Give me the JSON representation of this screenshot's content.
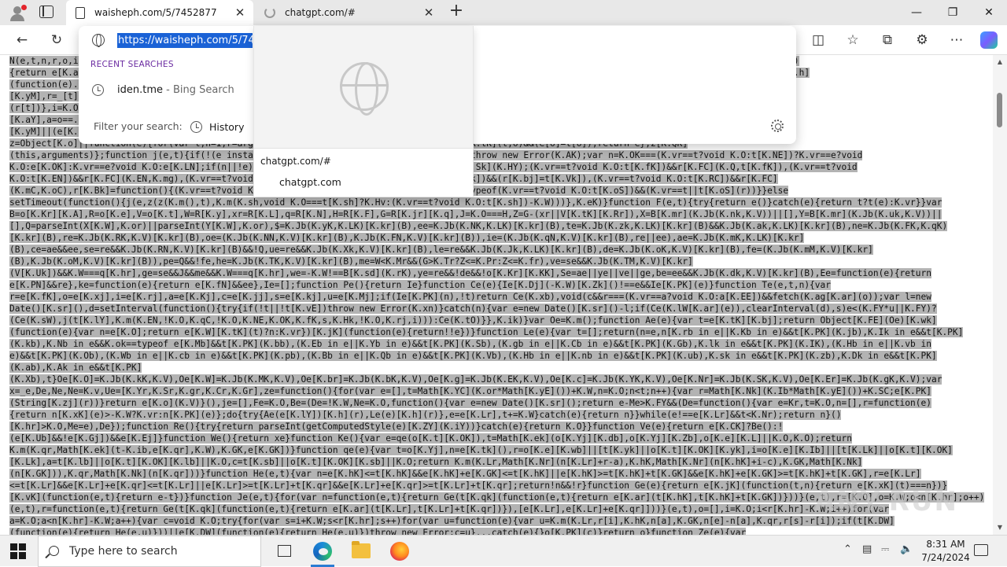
{
  "browser": {
    "tabs": [
      {
        "label": "waisheph.com/5/7452877",
        "close": "✕"
      },
      {
        "label": "chatgpt.com/#",
        "close": "✕"
      }
    ],
    "new_tab": "+",
    "window_controls": {
      "minimize": "—",
      "maximize": "❐",
      "close": "✕"
    }
  },
  "omnibox": {
    "url": "https://waisheph.com/5/7452877",
    "recent_heading": "RECENT SEARCHES",
    "recent_items": [
      {
        "term": "iden.tme",
        "source": " - Bing Search"
      }
    ],
    "filter_label": "Filter your search:",
    "history_label": "History"
  },
  "preview": {
    "url": "chatgpt.com/#",
    "title": "chatgpt.com"
  },
  "page": {
    "code_lines": [
      "N(e,t,n,r,o,i){...}......................................................................................................|L,s=Kr[c][K.jK](function(e)",
      "{return e[K.a............................................................................................................aS]=i[K.aS]),D[K.PK](u),_[K.h]",
      "(function(e)..............................................................................................................n=_[t][K.lY][K.tK][K.Rj]",
      "[K.yM],r=_[t]...............................................................................................................K]",
      "(r[t])},i=K.O...........................................................................................................[K.aY],o=e[K.xj],i=r===n[t]",
      "[K.aY],a=o==............................................................................................................(function(e){e[K.lY][K.Rj]",
      "[K.yM]||(e[K.............................................................................................................}});var z=function(){return",
      "z=Object[K.o]||function(e){for(var t,n=1,r=arguments...arguments[n])Object[K.tK][K.Rj][K.tK](t,o)&&(e[o]=t[o]);return e},z[K.QK]",
      "(this,arguments)};function j(e,t){if(!(e instanceof t))throw new TypeError(...t[K.Vk]))throw new Error(K.AK);var n=K.OK===(K.vr==t?void K.O:t[K.NE])?K.vr==e?void",
      "K.O:e[K.OK]:K.vr==e?void K.O:e[K.LN];if(n||!e){...................................r=e[K.Sk](K.HY);(K.vr==t?void K.O:t[K.fK])&&r[K.FC](K.Q,t[K.fK]),(K.vr==t?void",
      "K.O:t[K.EN])&&r[K.FC](K.EN,K.mg),(K.vr==t?void K.O:t[K.Vk])...........=t?void K.O:t[K.Vk])&&(r[K.bj]=t[K.Vk]),(K.vr==t?void K.O:t[K.RC])&&r[K.FC]",
      "(K.mC,K.oC),r[K.Bk]=function(){(K.vr==t?void K.O:t[K.sh])...........,n[K.Ck](r),K.ok==typeof(K.vr==t?void K.O:t[K.oS])&&(K.vr==t||t[K.oS](r))}}else",
      "setTimeout(function(){j(e,z(z(K.m(),t),K.m(K.sh,void K.O===t[K.sh]?K.Hv:(K.vr==t?void K.O:t[K.sh])-K.W)))},K.eK)}function F(e,t){try{return e()}catch(e){return t?t(e):K.vr}}var",
      "B=o[K.Kr][K.A],R=o[K.e],V=o[K.t],W=R[K.y],xr=R[K.L],q=R[K.N],H=R[K.F],G=R[K.jr][K.q],J=K.O===H,Z=G-(xr||V[K.tK][K.Rr]),X=B[K.mr](K.Jb(K.nk,K.V))||[],Y=B[K.mr](K.Jb(K.uk,K.V))||",
      "[],Q=parseInt(X[K.W],K.or)||parseInt(Y[K.W],K.or),$=K.Jb(K.yK,K.LK)[K.kr](B),ee=K.Jb(K.NK,K.LK)[K.kr](B),te=K.Jb(K.zk,K.LK)[K.kr](B)&&K.Jb(K.ak,K.LK)[K.kr](B),ne=K.Jb(K.FK,K.qK)",
      "[K.kr](B),re=K.Jb(K.RK,K.V)[K.kr](B),oe=(K.Jb(K.NN,K.V)[K.kr](B),K.Jb(K.FN,K.V)[K.kr](B)),ie=(K.Jb(K.qN,K.V)[K.kr](B),re||ee),ae=K.Jb(K.mK,K.LK)[K.kr]",
      "(B),ce=ae&&ee,se=re&&K.Jb(K.RN,K.V)[K.kr](B)&&!Q,ue=re&&K.Jb(K.Xk,K.V)[K.kr](B),le=re&&K.Jb(K.Jk,K.LK)[K.kr](B),de=K.Jb(K.oK,K.V)[K.kr](B),fe=(K.Jb(K.mM,K.V)[K.kr]",
      "(B),K.Jb(K.oM,K.V)[K.kr](B)),pe=Q&&!fe,he=K.Jb(K.TK,K.V)[K.kr](B),me=W<K.Mr&&(G>K.Tr?Z<=K.Pr:Z<=K.fr),ve=se&&K.Jb(K.TM,K.V)[K.kr]",
      "(V[K.Uk])&&K.W===q[K.hr],ge=se&&J&&me&&K.W===q[K.hr],we=-K.W!==B[K.sd](K.rK),ye=re&&!de&&!o[K.Kr][K.KK],Se=ae||ye||ve||ge,be=ee&&K.Jb(K.dk,K.V)[K.kr](B),Ee=function(e){return",
      "e[K.PN]&&re},ke=function(e){return e[K.fN]&&ee},Ie=[];function Pe(){return Ie}function Ce(e){Ie[K.Dj](-K.W)[K.Zk]()!==e&&Ie[K.PK](e)}function Te(e,t,n){var",
      "r=e[K.fK],o=e[K.xj],i=e[K.rj],a=e[K.Kj],c=e[K.jj],s=e[K.kj],u=e[K.Mj];if(Ie[K.PK](n),!t)return Ce(K.xb),void(c&&r===(K.vr==a?void K.O:a[K.EE])&&fetch(K.ag[K.ar](o));var l=new",
      "Date()[K.sr](),d=setInterval(function(){try{if(!t||!t[K.vE])throw new Error(K.xn)}catch(n){var e=new Date()[K.sr]()-l;if(Ce(K.lW[K.ar](e)),clearInterval(d),s)e<(K.FY*u||K.FY)?",
      "(Ce(K.sW),j(t[K.lY],K.m(K.EN,!K.O,K.qC,!K.O,K.NE,K.OK,K.fK,s,K.Hk,!K.O,K.rj,i))):Ce(K.tO)}},K.ik)}var Oe=K.m();function Ae(e){var t=e[K.tK][K.bj];return Object[K.FE](Oe)[K.wk]",
      "(function(e){var n=e[K.O];return e[K.W][K.tK](t)?n:K.vr})[K.jK](function(e){return!!e})}function Le(e){var t=[];return(n=e,n[K.rb in e||K.Kb in e)&&t[K.PK](K.jb),K.Ik in e&&t[K.PK]",
      "(K.kb),K.Nb in e&&K.ok==typeof e[K.Mb]&&t[K.PK](K.bb),(K.Eb in e||K.Yb in e)&&t[K.PK](K.Sb),(K.gb in e||K.Cb in e)&&t[K.PK](K.Gb),K.lk in e&&t[K.PK](K.IK),(K.Hb in e||K.vb in",
      "e)&&t[K.PK](K.Ob),(K.Wb in e||K.cb in e)&&t[K.PK](K.pb),(K.Bb in e||K.Qb in e)&&t[K.PK](K.Vb),(K.Hb in e||K.nb in e)&&t[K.PK](K.ub),K.sk in e&&t[K.PK](K.zb),K.Dk in e&&t[K.PK]",
      "(K.ab),K.Ak in e&&t[K.PK]",
      "(K.Xb),t}Oe[K.O]=K.Jb(K.kK,K.V),Oe[K.W]=K.Jb(K.MK,K.V),Oe[K.br]=K.Jb(K.bK,K.V),Oe[K.g]=K.Jb(K.EK,K.V),Oe[K.c]=K.Jb(K.YK,K.V),Oe[K.Nr]=K.Jb(K.SK,K.V),Oe[K.Er]=K.Jb(K.gK,K.V);var",
      "x=_e,De,Ne,Ne=K.v,Ue=[K.Yr,K.Sr,K.gr,K.Cr,K.Gr],ze=function(){for(var e=[],t=Math[K.YC](K.or*Math[K.yE]())+K.W,n=K.O;n<t;n++){var r=Math[K.Nk](K.Ib*Math[K.yE]())+K.SC;e[K.PK]",
      "(String[K.zj](r))}return e[K.o](K.V)}(),je=[],Fe=K.O,Be=(De=!K.W,Ne=K.O,function(){var e=new Date()[K.sr]();return e-Me>K.FY&&(De=function(){var e=Kr,t=K.O,n=[],r=function(e)",
      "{return n[K.xK](e)>-K.W?K.vr:n[K.PK](e)};do{try{Ae(e[K.lY])[K.h](r),Le(e)[K.h](r)},e=e[K.Lr],t+=K.W}catch(e){return n}}while(e!==e[K.Lr]&&t<K.Nr);return n}()",
      "[K.hr]>K.O,Me=e),De});function Re(){try{return parseInt(getComputedStyle(e)[K.ZY](K.iY))}catch(e){return K.O}}function Ve(e){return e[K.CK]?Be():!",
      "(e[K.Ub]&&!e[K.Gj])&&e[K.Ej]}function We(){return xe}function Ke(){var e=qe(o[K.t][K.OK]),t=Math[K.ek](o[K.Yj][K.db],o[K.Yj][K.Zb],o[K.e][K.L]||K.O,K.O);return",
      "K.m(K.qr,Math[K.ek](t-K.ib,e[K.qr],K.W),K.GK,e[K.GK])}function qe(e){var t=o[K.Yj],n=e[K.tk](),r=o[K.e][K.wb]||[t[K.yk]||o[K.t][K.OK][K.yk],i=o[K.e][K.Ib]||[t[K.Lk]||o[K.t][K.OK]",
      "[K.Lk],a=t[K.lb]||o[K.t][K.OK][K.lb]||K.O,c=t[K.sb]||o[K.t][K.OK][K.sb]||K.O;return K.m(K.Lr,Math[K.Nr](n[K.Lr]+r-a),K.hK,Math[K.Nr](n[K.hK]+i-c),K.GK,Math[K.Nk]",
      "(n[K.GK])),K.qr,Math[K.Nk](n[K.qr]))}function He(e,t){var n=e[K.hK]<=t[K.hK]&&e[K.hK]+e[K.GK]<=t[K.hK]||e[K.hK]>=t[K.hK]+t[K.GK]&&e[K.hK]+e[K.GK]>=t[K.hK]+t[K.GK],r=e[K.Lr]",
      "<=t[K.Lr]&&e[K.Lr]+e[K.qr]<=t[K.Lr]||e[K.Lr]>=t[K.Lr]+t[K.qr]&&e[K.Lr]+e[K.qr]>=t[K.Lr]+t[K.qr];return!n&&!r}function Ge(e){return e[K.jK](function(t,n){return e[K.xK](t)===n})}",
      "[K.vK](function(e,t){return e-t})}function Je(e,t){for(var n=function(e,t){return Ge(t[K.qk](function(e,t){return e[K.ar](t[K.hK],t[K.hK]+t[K.GK])}))}(e,t),r=[K.O],o=K.W;o<n[K.hr];o++)",
      "(e,t),r=function(e,t){return Ge(t[K.qk](function(e,t){return e[K.ar](t[K.Lr],t[K.Lr]+t[K.qr])}),[e[K.Lr],e[K.Lr]+e[K.qr]]))}(e,t),o=[],i=K.O;i<r[K.hr]-K.W;i++)for(var",
      "a=K.O;a<n[K.hr]-K.W;a++){var c=void K.O;try{for(var s=i+K.W;s<r[K.hr];s++)for(var u=function(e){var u=K.m(K.Lr,r[i],K.hK,n[a],K.GK,n[e]-n[a],K.qr,r[s]-r[i]);if(t[K.DW]",
      "(function(e){return He(e,u)}))||e[K.DW](function(e){return He(e,u)})throw new Error;c=u}...catch(e){}o[K.PK](c)}return o}function Ze(e){var"
    ]
  },
  "watermark": "ANY.RUN",
  "taskbar": {
    "search_placeholder": "Type here to search",
    "time": "8:31 AM",
    "date": "7/24/2024"
  },
  "icons": [
    "profile-icon",
    "tab-actions-icon",
    "page-icon",
    "loading-icon",
    "back-icon",
    "refresh-icon",
    "globe-icon",
    "history-icon",
    "gear-icon",
    "split-screen-icon",
    "favorites-icon",
    "collections-icon",
    "extensions-icon",
    "more-icon",
    "copilot-icon",
    "windows-start-icon",
    "search-icon",
    "task-view-icon",
    "edge-icon",
    "file-explorer-icon",
    "firefox-icon",
    "chevron-up-icon",
    "network-icon",
    "volume-icon",
    "notification-icon"
  ],
  "colors": {
    "selection": "#1a62d6",
    "recent_heading": "#6a2aa0",
    "code_selection": "#b3b3b3",
    "taskbar": "#f0f0f0"
  }
}
